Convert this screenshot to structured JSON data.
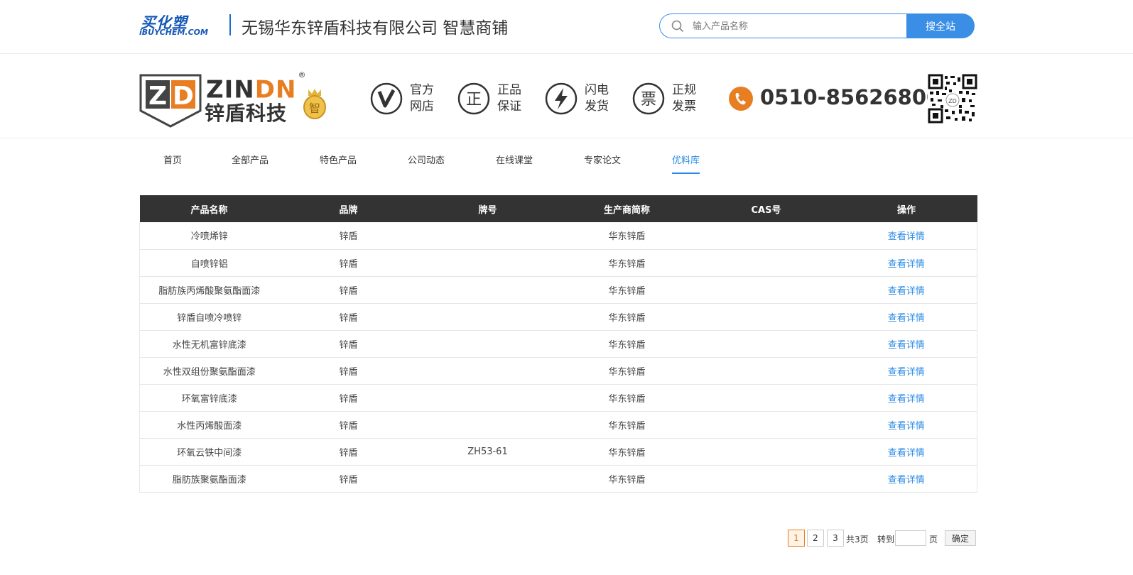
{
  "site": {
    "logo_cn": "买化塑",
    "logo_en": "iBUYCHEM.COM",
    "shop_title": "无锡华东锌盾科技有限公司 智慧商铺"
  },
  "search": {
    "placeholder": "输入产品名称",
    "button_label": "搜全站"
  },
  "brand": {
    "emblem_letters": "ZD",
    "name_en_left": "ZIN",
    "name_en_right": "DN",
    "registered": "®",
    "name_cn": "锌盾科技",
    "medal_char": "智",
    "accent_color": "#e87e22"
  },
  "guarantees": [
    {
      "icon": "v-check-icon",
      "line1": "官方",
      "line2": "网店"
    },
    {
      "icon": "zheng-icon",
      "icon_char": "正",
      "line1": "正品",
      "line2": "保证"
    },
    {
      "icon": "lightning-icon",
      "line1": "闪电",
      "line2": "发货"
    },
    {
      "icon": "invoice-icon",
      "icon_char": "票",
      "line1": "正规",
      "line2": "发票"
    }
  ],
  "phone": "0510-85626800",
  "nav": {
    "items": [
      "首页",
      "全部产品",
      "特色产品",
      "公司动态",
      "在线课堂",
      "专家论文",
      "优料库"
    ],
    "active": "优料库",
    "active_color": "#2a8ae4"
  },
  "table": {
    "headers": [
      "产品名称",
      "品牌",
      "牌号",
      "生产商简称",
      "CAS号",
      "操作"
    ],
    "rows": [
      {
        "name": "冷喷烯锌",
        "brand": "锌盾",
        "grade": "",
        "maker": "华东锌盾",
        "cas": "",
        "action": "查看详情"
      },
      {
        "name": "自喷锌铝",
        "brand": "锌盾",
        "grade": "",
        "maker": "华东锌盾",
        "cas": "",
        "action": "查看详情"
      },
      {
        "name": "脂肪族丙烯酸聚氨酯面漆",
        "brand": "锌盾",
        "grade": "",
        "maker": "华东锌盾",
        "cas": "",
        "action": "查看详情"
      },
      {
        "name": "锌盾自喷冷喷锌",
        "brand": "锌盾",
        "grade": "",
        "maker": "华东锌盾",
        "cas": "",
        "action": "查看详情"
      },
      {
        "name": "水性无机富锌底漆",
        "brand": "锌盾",
        "grade": "",
        "maker": "华东锌盾",
        "cas": "",
        "action": "查看详情"
      },
      {
        "name": "水性双组份聚氨酯面漆",
        "brand": "锌盾",
        "grade": "",
        "maker": "华东锌盾",
        "cas": "",
        "action": "查看详情"
      },
      {
        "name": "环氧富锌底漆",
        "brand": "锌盾",
        "grade": "",
        "maker": "华东锌盾",
        "cas": "",
        "action": "查看详情"
      },
      {
        "name": "水性丙烯酸面漆",
        "brand": "锌盾",
        "grade": "",
        "maker": "华东锌盾",
        "cas": "",
        "action": "查看详情"
      },
      {
        "name": "环氧云铁中间漆",
        "brand": "锌盾",
        "grade": "ZH53-61",
        "maker": "华东锌盾",
        "cas": "",
        "action": "查看详情"
      },
      {
        "name": "脂肪族聚氨酯面漆",
        "brand": "锌盾",
        "grade": "",
        "maker": "华东锌盾",
        "cas": "",
        "action": "查看详情"
      }
    ]
  },
  "pagination": {
    "pages": [
      "1",
      "2",
      "3"
    ],
    "current": "1",
    "total_text": "共3页",
    "goto_label": "转到",
    "page_suffix": "页",
    "goto_value": "",
    "confirm_label": "确定"
  }
}
